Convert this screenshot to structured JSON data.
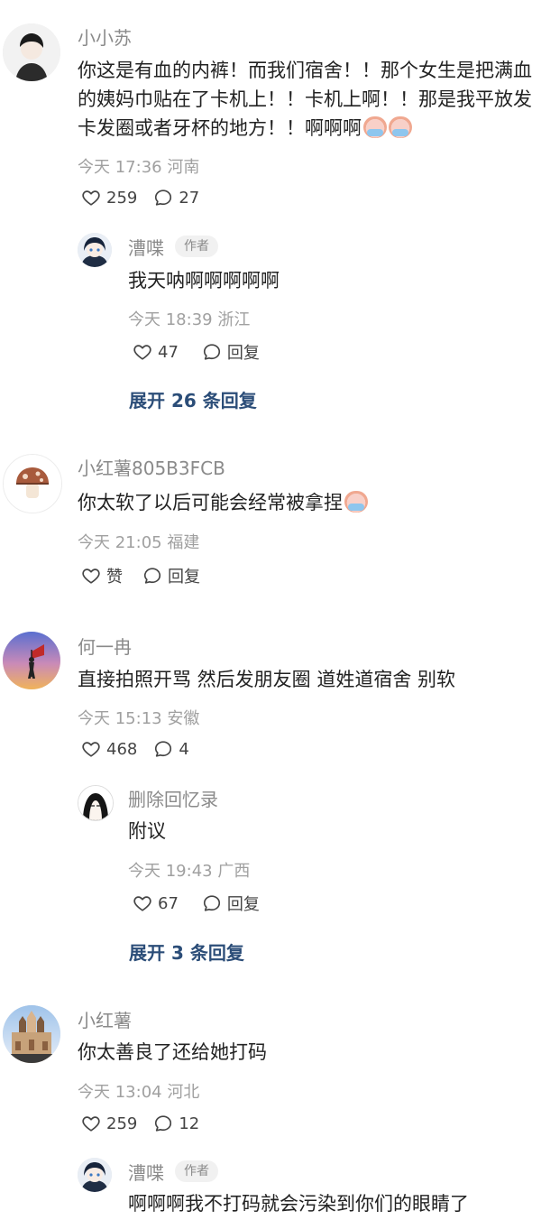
{
  "comments": [
    {
      "name": "小小苏",
      "text": "你这是有血的内裤！而我们宿舍！！那个女生是把满血的姨妈巾贴在了卡机上！！卡机上啊！！那是我平放发卡发圈或者牙杯的地方！！啊啊啊",
      "meta": "今天 17:36 河南",
      "likes": "259",
      "replies_count": "27",
      "reply": {
        "name": "漕喋",
        "badge": "作者",
        "text": "我天呐啊啊啊啊啊",
        "meta": "今天 18:39 浙江",
        "likes": "47",
        "reply_label": "回复"
      },
      "expand": "展开 26 条回复"
    },
    {
      "name": "小红薯805B3FCB",
      "text": "你太软了以后可能会经常被拿捏",
      "meta": "今天 21:05 福建",
      "likes": "赞",
      "reply_label": "回复"
    },
    {
      "name": "何一冉",
      "text": "直接拍照开骂 然后发朋友圈 道姓道宿舍 别软",
      "meta": "今天 15:13 安徽",
      "likes": "468",
      "replies_count": "4",
      "reply": {
        "name": "删除回忆录",
        "text": "附议",
        "meta": "今天 19:43 广西",
        "likes": "67",
        "reply_label": "回复"
      },
      "expand": "展开 3 条回复"
    },
    {
      "name": "小红薯",
      "text": "你太善良了还给她打码",
      "meta": "今天 13:04 河北",
      "likes": "259",
      "replies_count": "12",
      "reply": {
        "name": "漕喋",
        "badge": "作者",
        "text": "啊啊啊我不打码就会污染到你们的眼睛了"
      }
    }
  ]
}
